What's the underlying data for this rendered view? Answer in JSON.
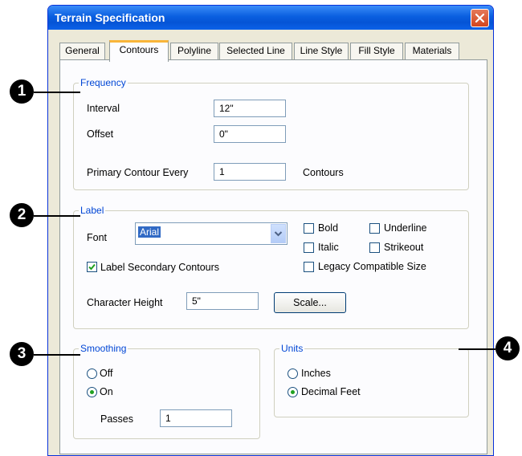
{
  "dialog": {
    "title": "Terrain Specification",
    "close_icon": "close-icon"
  },
  "tabs": [
    {
      "label": "General"
    },
    {
      "label": "Contours",
      "active": true
    },
    {
      "label": "Polyline"
    },
    {
      "label": "Selected Line"
    },
    {
      "label": "Line Style"
    },
    {
      "label": "Fill Style"
    },
    {
      "label": "Materials"
    }
  ],
  "frequency": {
    "legend": "Frequency",
    "interval_label": "Interval",
    "interval_value": "12\"",
    "offset_label": "Offset",
    "offset_value": "0\"",
    "primary_label": "Primary Contour Every",
    "primary_value": "1",
    "primary_suffix": "Contours"
  },
  "label_group": {
    "legend": "Label",
    "font_label": "Font",
    "font_value": "Arial",
    "bold": {
      "label": "Bold",
      "checked": false
    },
    "underline": {
      "label": "Underline",
      "checked": false
    },
    "italic": {
      "label": "Italic",
      "checked": false
    },
    "strikeout": {
      "label": "Strikeout",
      "checked": false
    },
    "legacy": {
      "label": "Legacy Compatible Size",
      "checked": false
    },
    "secondary": {
      "label": "Label Secondary Contours",
      "checked": true
    },
    "char_height_label": "Character Height",
    "char_height_value": "5\"",
    "scale_button": "Scale..."
  },
  "smoothing": {
    "legend": "Smoothing",
    "off_label": "Off",
    "on_label": "On",
    "selected": "On",
    "passes_label": "Passes",
    "passes_value": "1"
  },
  "units": {
    "legend": "Units",
    "inches_label": "Inches",
    "decimal_feet_label": "Decimal Feet",
    "selected": "Decimal Feet"
  },
  "callouts": [
    "1",
    "2",
    "3",
    "4"
  ],
  "colors": {
    "title_bar": "#0a5fe0",
    "legend_text": "#0046d5",
    "active_tab_accent": "#f9b53a",
    "close_button": "#d2451e",
    "radio_dot": "#21a121",
    "checkmark": "#21a121"
  }
}
